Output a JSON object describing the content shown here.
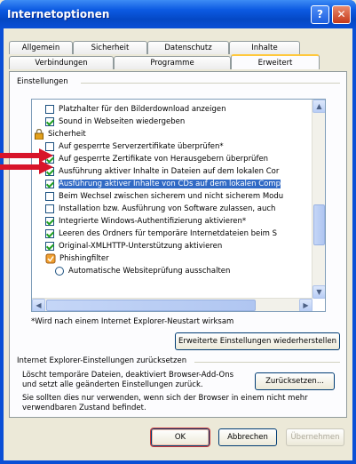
{
  "window": {
    "title": "Internetoptionen",
    "help_label": "?",
    "close_label": "✕"
  },
  "tabs_row1": [
    "Allgemein",
    "Sicherheit",
    "Datenschutz",
    "Inhalte"
  ],
  "tabs_row2": [
    "Verbindungen",
    "Programme",
    "Erweitert"
  ],
  "active_tab": "Erweitert",
  "settings_group_label": "Einstellungen",
  "settings_items": [
    {
      "label": "Platzhalter für den Bilderdownload anzeigen",
      "control": "checkbox",
      "checked": false
    },
    {
      "label": "Sound in Webseiten wiedergeben",
      "control": "checkbox",
      "checked": true
    },
    {
      "label": "Sicherheit",
      "control": "category"
    },
    {
      "label": "Auf gesperrte Serverzertifikate überprüfen*",
      "control": "checkbox",
      "checked": false
    },
    {
      "label": "Auf gesperrte Zertifikate von Herausgebern überprüfen",
      "control": "checkbox",
      "checked": true
    },
    {
      "label": "Ausführung aktiver Inhalte in Dateien auf dem lokalen Cor",
      "control": "checkbox",
      "checked": true
    },
    {
      "label": "Ausführung aktiver Inhalte von CDs auf dem lokalen Comp",
      "control": "checkbox",
      "checked": true,
      "selected": true
    },
    {
      "label": "Beim Wechsel zwischen sicherem und nicht sicherem Modu",
      "control": "checkbox",
      "checked": false
    },
    {
      "label": "Installation bzw. Ausführung von Software zulassen, auch",
      "control": "checkbox",
      "checked": false
    },
    {
      "label": "Integrierte Windows-Authentifizierung aktivieren*",
      "control": "checkbox",
      "checked": true
    },
    {
      "label": "Leeren des Ordners für temporäre Internetdateien beim S",
      "control": "checkbox",
      "checked": true
    },
    {
      "label": "Original-XMLHTTP-Unterstützung aktivieren",
      "control": "checkbox",
      "checked": true
    },
    {
      "label": "Phishingfilter",
      "control": "category"
    },
    {
      "label": "Automatische Websiteprüfung ausschalten",
      "control": "radio",
      "checked": false
    }
  ],
  "restart_note": "*Wird nach einem Internet Explorer-Neustart wirksam",
  "restore_button": "Erweiterte Einstellungen wiederherstellen",
  "reset_group_label": "Internet Explorer-Einstellungen zurücksetzen",
  "reset_description": "Löscht temporäre Dateien, deaktiviert Browser-Add-Ons und setzt alle geänderten Einstellungen zurück.",
  "reset_button": "Zurücksetzen...",
  "reset_warning": "Sie sollten dies nur verwenden, wenn sich der Browser in einem nicht mehr verwendbaren Zustand befindet.",
  "footer_buttons": {
    "ok": "OK",
    "cancel": "Abbrechen",
    "apply": "Übernehmen"
  },
  "colors": {
    "title_bar": "#0a4fd6",
    "selection": "#316ac5",
    "annotation_arrow": "#d8142a"
  }
}
